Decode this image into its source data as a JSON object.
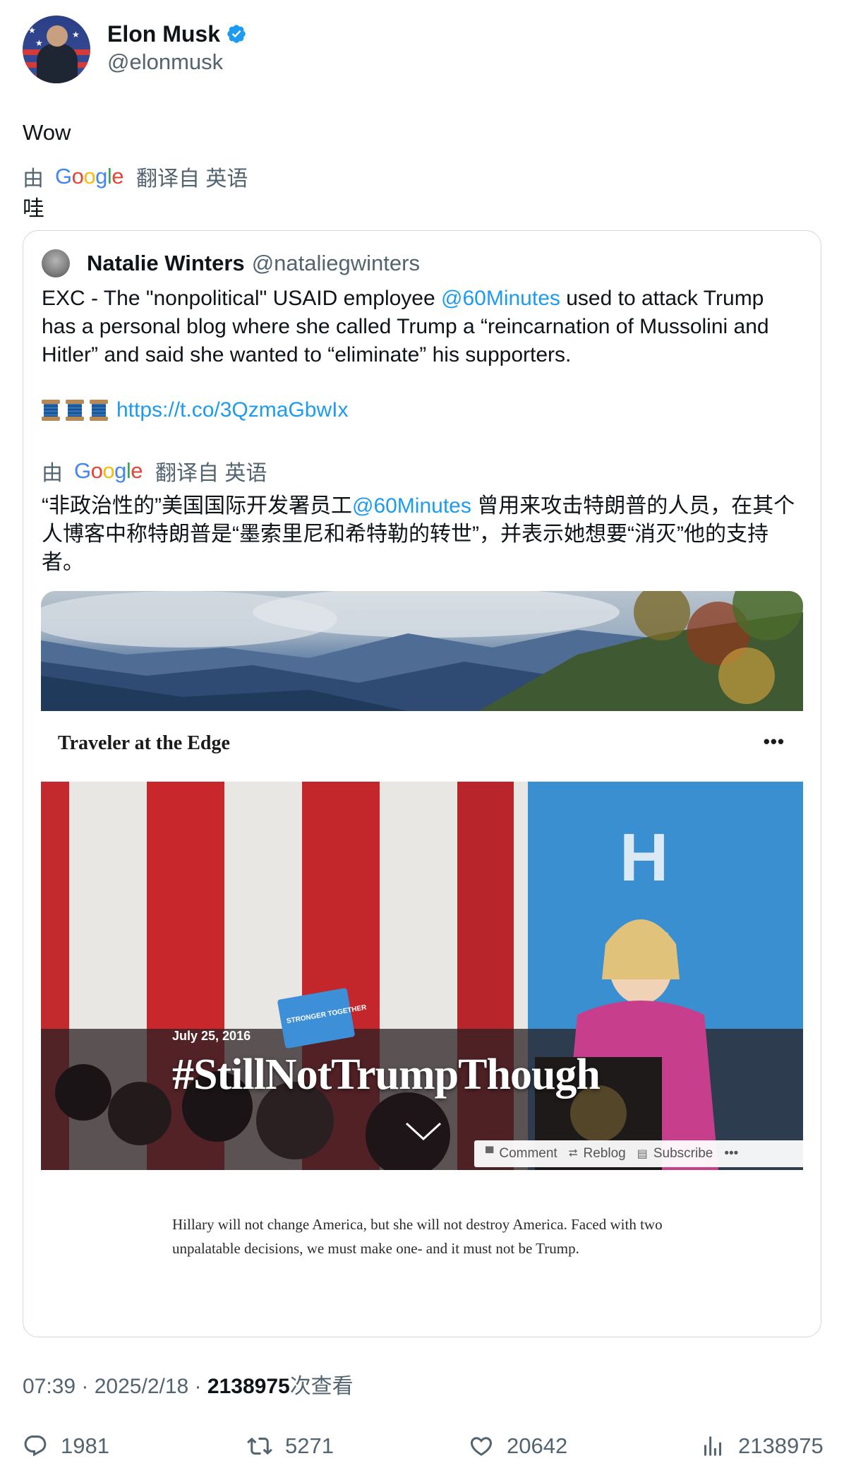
{
  "author": {
    "display_name": "Elon Musk",
    "handle": "@elonmusk",
    "verified_icon": "verified-badge-icon"
  },
  "tweet": {
    "text": "Wow",
    "translate_prefix": "由",
    "translate_brand": "Google",
    "translate_suffix": "翻译自 英语",
    "translated_text": "哇"
  },
  "quote": {
    "display_name": "Natalie Winters",
    "handle": "@nataliegwinters",
    "text_part1": "EXC - The \"nonpolitical\" USAID employee ",
    "mention": "@60Minutes",
    "text_part2": "  used to attack Trump has a personal blog where she called Trump a “reincarnation of Mussolini and Hitler” and said she wanted to “eliminate” his supporters.",
    "link": "https://t.co/3QzmaGbwIx",
    "translate_prefix": "由",
    "translate_brand": "Google",
    "translate_suffix": "翻译自 英语",
    "translated_part1": "“非政治性的”美国国际开发署员工",
    "translated_mention": "@60Minutes",
    "translated_part2": " 曾用来攻击特朗普的人员，在其个人博客中称特朗普是“墨索里尼和希特勒的转世”，并表示她想要“消灭”他的支持者。"
  },
  "embed": {
    "blog_title": "Traveler at the Edge",
    "menu": "•••",
    "post_date": "July 25, 2016",
    "post_title": "#StillNotTrumpThough",
    "sign_text": "STRONGER TOGETHER",
    "bar": {
      "comment": "Comment",
      "reblog": "Reblog",
      "subscribe": "Subscribe",
      "more": "•••"
    },
    "excerpt": "Hillary will not change America, but she will not destroy America. Faced with two unpalatable decisions, we must make one- and it must not be Trump."
  },
  "meta": {
    "time": "07:39",
    "sep1": " · ",
    "date": "2025/2/18",
    "sep2": " · ",
    "views": "2138975",
    "views_label": "次查看"
  },
  "actions": {
    "replies": "1981",
    "retweets": "5271",
    "likes": "20642",
    "view_count": "2138975"
  },
  "colors": {
    "link": "#1d9bf0",
    "muted": "#536471",
    "border": "#cfd9de"
  }
}
